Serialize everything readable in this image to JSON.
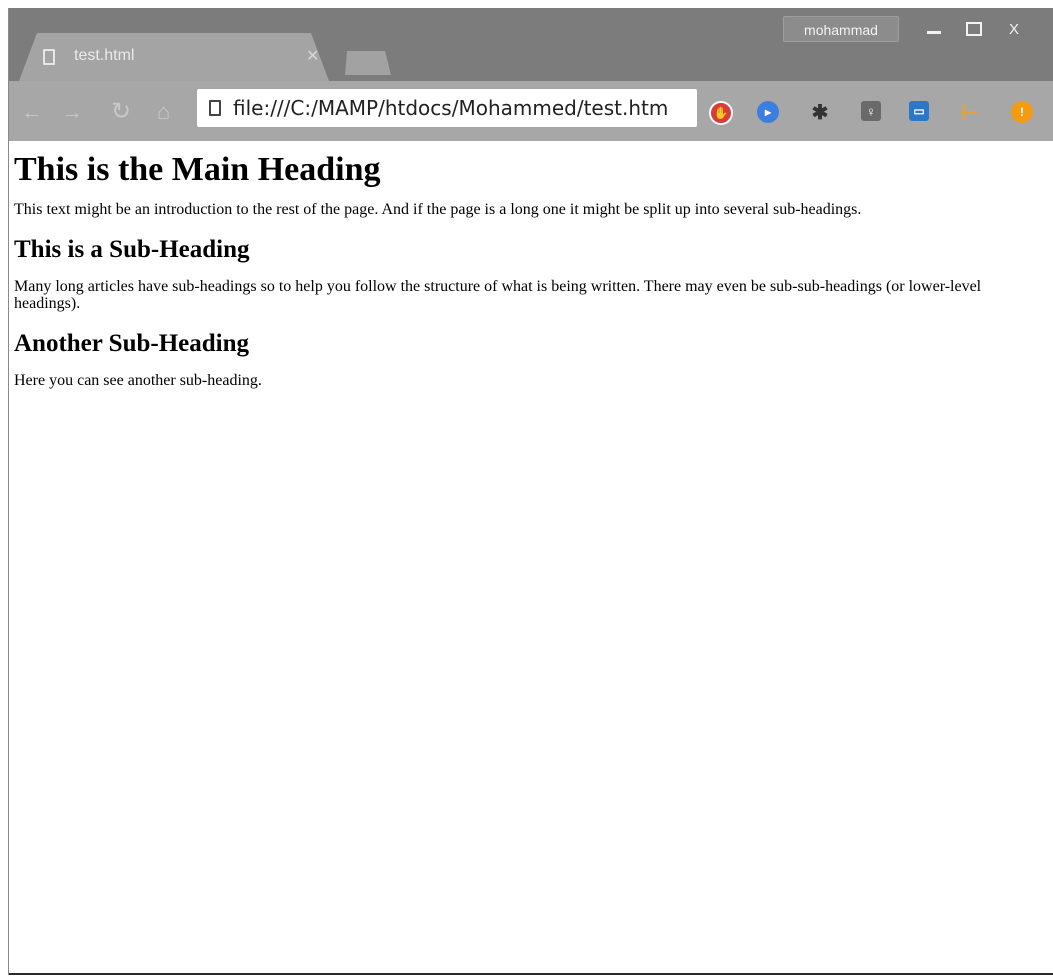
{
  "window": {
    "tab_title": "test.html",
    "profile_name": "mohammad",
    "close_label": "X"
  },
  "toolbar": {
    "url": "file:///C:/MAMP/htdocs/Mohammed/test.htm"
  },
  "page": {
    "heading_main": "This is the Main Heading",
    "intro": "This text might be an introduction to the rest of the page. And if the page is a long one it might be split up into several sub-headings.",
    "sub1_title": "This is a Sub-Heading",
    "sub1_text": "Many long articles have sub-headings so to help you follow the structure of what is being written. There may even be sub-sub-headings (or lower-level headings).",
    "sub2_title": "Another Sub-Heading",
    "sub2_text": "Here you can see another sub-heading."
  },
  "extensions": [
    "stop-sign-icon",
    "video-icon",
    "gear-icon",
    "lightbulb-icon",
    "save-icon",
    "tool-icon",
    "warning-icon"
  ],
  "colors": {
    "titlebar": "#7c7c7c",
    "tab": "#a4a4a4",
    "toolbar": "#a7a7a7",
    "stop_red": "#d93a3a",
    "video_blue": "#3b7ee0",
    "save_blue": "#2b77c9",
    "warning_orange": "#f39c12"
  }
}
